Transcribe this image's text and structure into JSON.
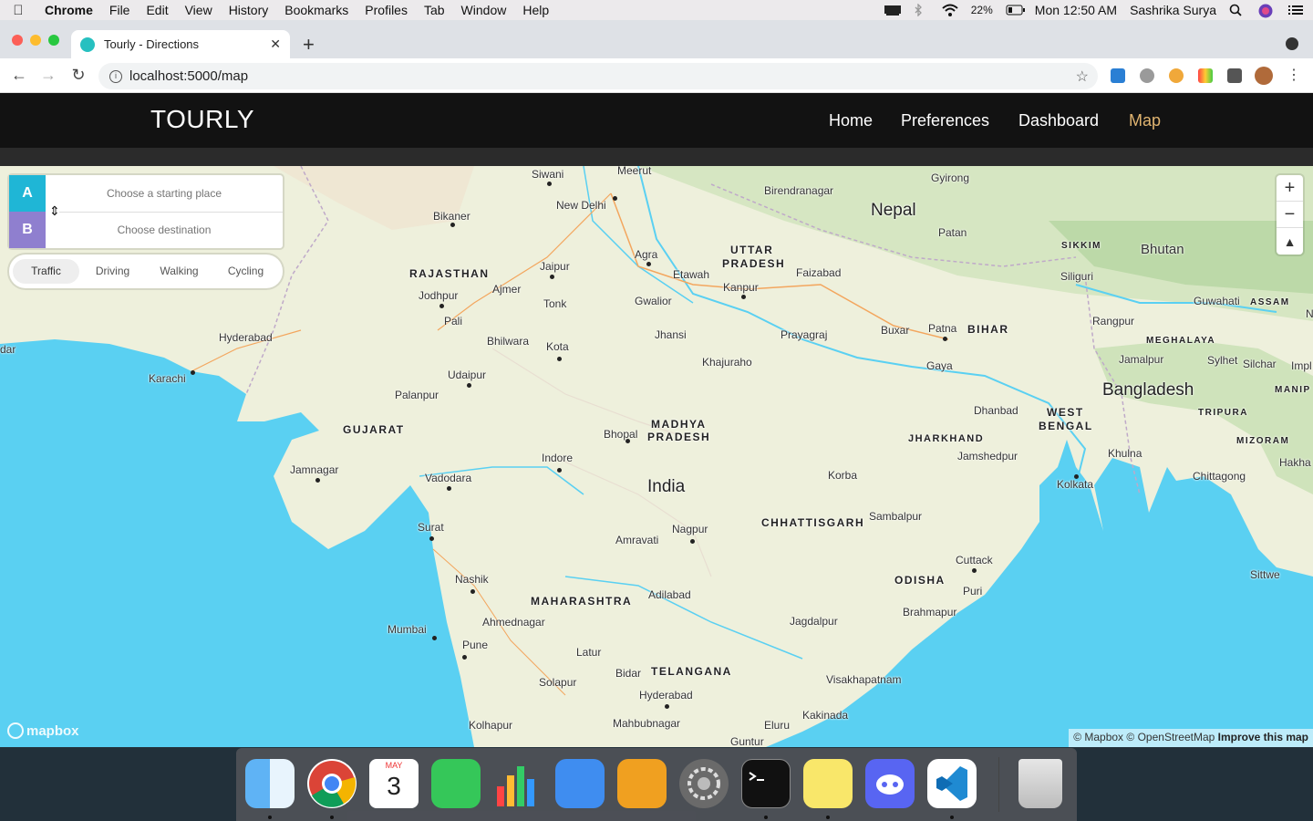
{
  "menubar": {
    "app_name": "Chrome",
    "items": [
      "File",
      "Edit",
      "View",
      "History",
      "Bookmarks",
      "Profiles",
      "Tab",
      "Window",
      "Help"
    ],
    "battery": "22%",
    "clock": "Mon 12:50 AM",
    "user": "Sashrika Surya"
  },
  "browser": {
    "tab_title": "Tourly - Directions",
    "url": "localhost:5000/map"
  },
  "app": {
    "brand": "TOURLY",
    "nav": [
      "Home",
      "Preferences",
      "Dashboard",
      "Map"
    ],
    "active_nav": "Map",
    "active_color": "#e0b470"
  },
  "directions": {
    "origin_tag": "A",
    "destination_tag": "B",
    "origin_placeholder": "Choose a starting place",
    "destination_placeholder": "Choose destination",
    "origin_color": "#1fb6d6",
    "destination_color": "#8f7fcf",
    "profiles": [
      "Traffic",
      "Driving",
      "Walking",
      "Cycling"
    ],
    "active_profile": "Traffic"
  },
  "map": {
    "labels": {
      "siwani": "Siwani",
      "meerut": "Meerut",
      "gyirong": "Gyirong",
      "birendranagar": "Birendranagar",
      "new_delhi": "New Delhi",
      "nepal": "Nepal",
      "bikaner": "Bikaner",
      "patan": "Patan",
      "sikkim": "SIKKIM",
      "bhutan": "Bhutan",
      "agra": "Agra",
      "uttar_pradesh_1": "UTTAR",
      "uttar_pradesh_2": "PRADESH",
      "rajasthan": "RAJASTHAN",
      "jaipur": "Jaipur",
      "etawah": "Etawah",
      "faizabad": "Faizabad",
      "siliguri": "Siliguri",
      "jodhpur": "Jodhpur",
      "ajmer": "Ajmer",
      "kanpur": "Kanpur",
      "guwahati": "Guwahati",
      "assam": "ASSAM",
      "tonk": "Tonk",
      "gwalior": "Gwalior",
      "pali": "Pali",
      "rangpur": "Rangpur",
      "hyderabad_pk": "Hyderabad",
      "jhansi": "Jhansi",
      "buxar": "Buxar",
      "patna": "Patna",
      "bihar": "BIHAR",
      "bhilwara": "Bhilwara",
      "kota": "Kota",
      "prayagraj": "Prayagraj",
      "meghalaya": "MEGHALAYA",
      "jamalpur": "Jamalpur",
      "sylhet": "Sylhet",
      "silchar": "Silchar",
      "karachi": "Karachi",
      "khajuraho": "Khajuraho",
      "gaya": "Gaya",
      "udaipur": "Udaipur",
      "bangladesh": "Bangladesh",
      "manipur": "MANIP",
      "palanpur": "Palanpur",
      "dhanbad": "Dhanbad",
      "west_bengal_1": "WEST",
      "west_bengal_2": "BENGAL",
      "tripura": "TRIPURA",
      "madhya_pradesh_1": "MADHYA",
      "madhya_pradesh_2": "PRADESH",
      "gujarat": "GUJARAT",
      "bhopal": "Bhopal",
      "jharkhand": "JHARKHAND",
      "mizoram": "MIZORAM",
      "jamshedpur": "Jamshedpur",
      "khulna": "Khulna",
      "indore": "Indore",
      "jamnagar": "Jamnagar",
      "hakha": "Hakha",
      "vadodara": "Vadodara",
      "india": "India",
      "korba": "Korba",
      "chittagong": "Chittagong",
      "kolkata": "Kolkata",
      "sambalpur": "Sambalpur",
      "chhattisgarh": "CHHATTISGARH",
      "surat": "Surat",
      "nagpur": "Nagpur",
      "amravati": "Amravati",
      "cuttack": "Cuttack",
      "sittwe": "Sittwe",
      "nashik": "Nashik",
      "odisha": "ODISHA",
      "puri": "Puri",
      "adilabad": "Adilabad",
      "maharashtra": "MAHARASHTRA",
      "ahmednagar": "Ahmednagar",
      "brahmapur": "Brahmapur",
      "jagdalpur": "Jagdalpur",
      "mumbai": "Mumbai",
      "pune": "Pune",
      "latur": "Latur",
      "bidar": "Bidar",
      "telangana": "TELANGANA",
      "solapur": "Solapur",
      "visakhapatnam": "Visakhapatnam",
      "hyderabad_in": "Hyderabad",
      "kakinada": "Kakinada",
      "kolhapur": "Kolhapur",
      "mahbubnagar": "Mahbubnagar",
      "eluru": "Eluru",
      "guntur": "Guntur",
      "dar": "dar",
      "impl": "Impl",
      "n": "N"
    }
  },
  "attribution": {
    "mapbox": "© Mapbox",
    "osm": "© OpenStreetMap",
    "improve": "Improve this map",
    "logo": "mapbox"
  },
  "dock": {
    "calendar_month": "MAY",
    "calendar_day": "3"
  }
}
